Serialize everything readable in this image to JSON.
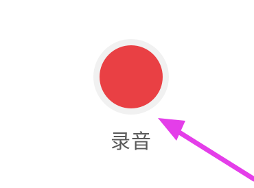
{
  "record": {
    "label": "录音"
  },
  "colors": {
    "record_dot": "#e94044",
    "record_ring": "#f1f1f1",
    "label_text": "#595959",
    "arrow": "#e43ee9"
  },
  "icons": {
    "record": "red-record-dot",
    "pointer": "magenta-arrow"
  }
}
